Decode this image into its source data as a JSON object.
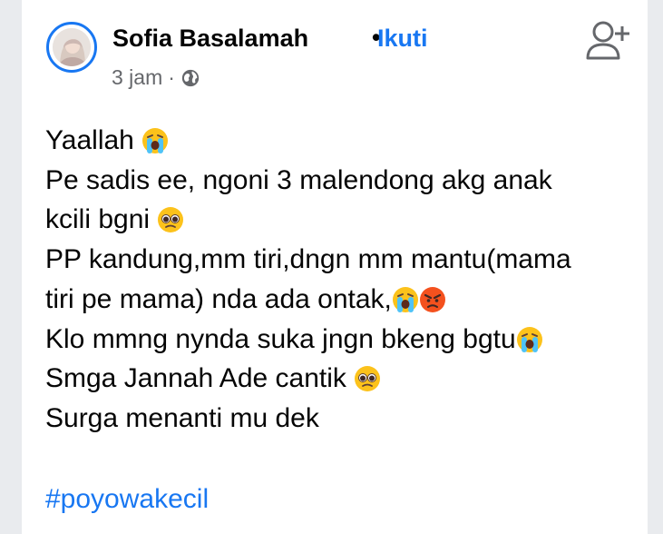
{
  "post": {
    "author": "Sofia Basalamah",
    "separator": "•",
    "follow_label": "Ikuti",
    "time": "3 jam",
    "meta_dot": "·",
    "privacy_icon": "globe-icon",
    "add_friend_icon": "add-friend-icon",
    "lines": {
      "l1": "Yaallah",
      "l2": "Pe sadis ee, ngoni 3 malendong akg anak",
      "l3": "kcili bgni",
      "l4": "PP kandung,mm tiri,dngn mm mantu(mama",
      "l5": "tiri pe mama) nda ada ontak,",
      "l6": "Klo mmng nynda suka jngn bkeng bgtu",
      "l7": "Smga Jannah Ade cantik",
      "l8": "Surga menanti mu dek"
    },
    "hashtag": "#poyowakecil"
  },
  "colors": {
    "link_blue": "#1877f2",
    "text": "#050505",
    "secondary_text": "#65676b"
  }
}
